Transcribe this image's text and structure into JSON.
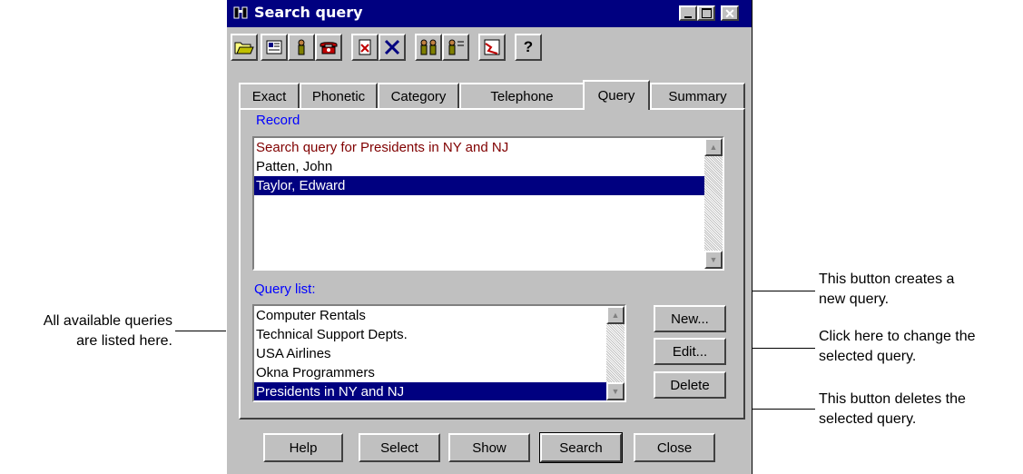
{
  "window": {
    "title": "Search query",
    "controls": [
      "minimize",
      "maximize",
      "close"
    ]
  },
  "toolbar": {
    "tools": [
      "open-folder-icon",
      "card-icon",
      "person-icon",
      "telephone-icon",
      "delete-doc-icon",
      "cross-icon",
      "people-icon",
      "person-list-icon",
      "chart-icon",
      "help-icon"
    ],
    "help_label": "?"
  },
  "tabs": [
    "Exact",
    "Phonetic",
    "Category",
    "Telephone",
    "Query",
    "Summary"
  ],
  "active_tab": "Query",
  "record": {
    "label": "Record",
    "items": [
      "Search query for Presidents in NY and NJ",
      "Patten, John",
      "Taylor, Edward"
    ],
    "selected_index": 2
  },
  "query_list": {
    "label": "Query list:",
    "items": [
      "Computer Rentals",
      "Technical Support Depts.",
      "USA Airlines",
      "Okna Programmers",
      "Presidents in NY and NJ"
    ],
    "selected_index": 4
  },
  "side_buttons": {
    "new": "New...",
    "edit": "Edit...",
    "delete": "Delete"
  },
  "bottom_buttons": [
    "Help",
    "Select",
    "Show",
    "Search",
    "Close"
  ],
  "annotations": {
    "left": [
      "All available queries",
      "are listed here."
    ],
    "new": [
      "This button creates a",
      "new query."
    ],
    "edit": [
      "Click here to change the",
      "selected query."
    ],
    "delete": [
      "This button deletes the",
      "selected query."
    ]
  }
}
